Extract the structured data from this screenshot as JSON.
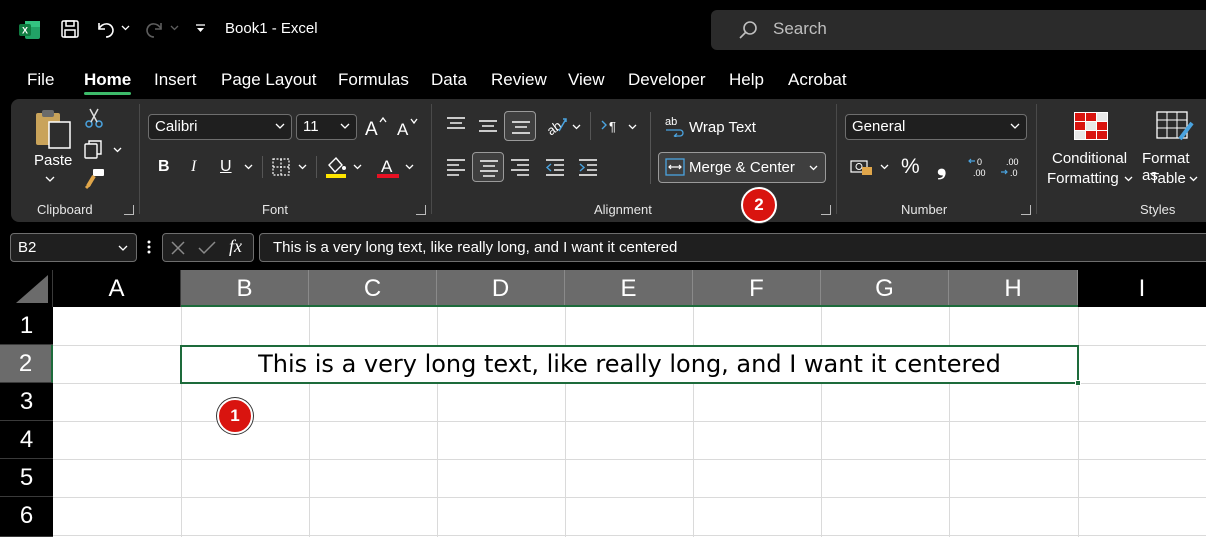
{
  "titlebar": {
    "title": "Book1  -  Excel",
    "search_placeholder": "Search"
  },
  "menu": {
    "file": "File",
    "home": "Home",
    "insert": "Insert",
    "page_layout": "Page Layout",
    "formulas": "Formulas",
    "data": "Data",
    "review": "Review",
    "view": "View",
    "developer": "Developer",
    "help": "Help",
    "acrobat": "Acrobat"
  },
  "ribbon": {
    "clipboard": {
      "paste": "Paste",
      "label": "Clipboard"
    },
    "font": {
      "name": "Calibri",
      "size": "11",
      "label": "Font",
      "bold": "B",
      "italic": "I",
      "underline": "U"
    },
    "alignment": {
      "wrap_text": "Wrap Text",
      "merge_center": "Merge & Center",
      "label": "Alignment"
    },
    "number": {
      "format": "General",
      "percent": "%",
      "comma": "❟",
      "label": "Number"
    },
    "styles": {
      "conditional_1": "Conditional",
      "conditional_2": "Formatting",
      "format_as_1": "Format as",
      "format_as_2": "Table",
      "label": "Styles"
    }
  },
  "formula_bar": {
    "name_box": "B2",
    "fx": "fx",
    "content": "This is a very long text, like really long, and I want it centered"
  },
  "sheet": {
    "columns": [
      "A",
      "B",
      "C",
      "D",
      "E",
      "F",
      "G",
      "H",
      "I"
    ],
    "rows": [
      "1",
      "2",
      "3",
      "4",
      "5",
      "6"
    ],
    "merged_text": "This is a very long text, like really long, and I want it centered"
  },
  "annotations": {
    "badge1": "1",
    "badge2": "2"
  },
  "colors": {
    "accent_green": "#1d6b3b",
    "underline_green": "#3dbb6a",
    "badge_red": "#d9140f"
  }
}
